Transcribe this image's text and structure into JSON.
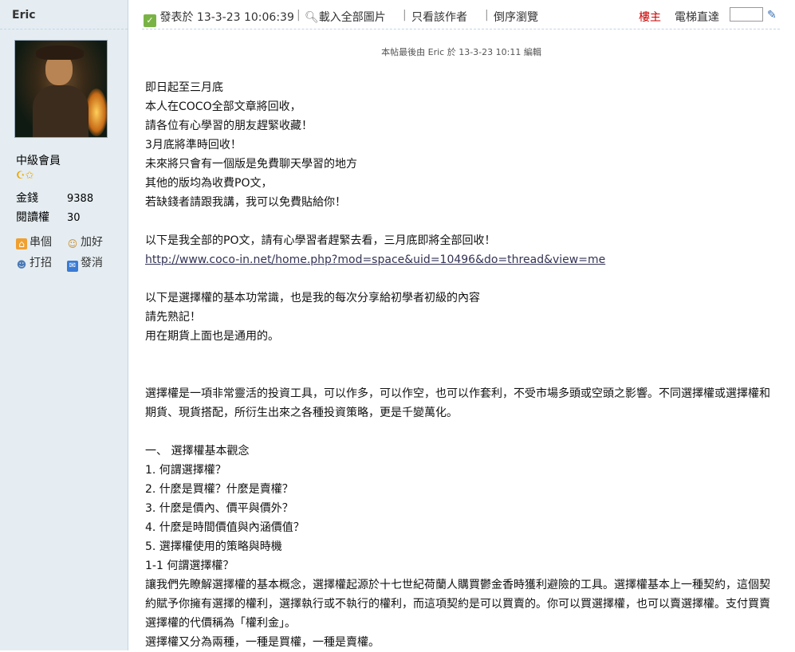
{
  "sidebar": {
    "username": "Eric",
    "rank": "中級會員",
    "stars": "☪✩",
    "stats": [
      {
        "label": "金錢",
        "value": "9388"
      },
      {
        "label": "閱讀權",
        "value": "30"
      }
    ],
    "actions": [
      {
        "label": "串個"
      },
      {
        "label": "加好"
      },
      {
        "label": "打招"
      },
      {
        "label": "發消"
      }
    ]
  },
  "toolbar": {
    "posted_prefix": "發表於",
    "posted_time": "13-3-23 10:06:39",
    "sep": "|",
    "load_images": "載入全部圖片",
    "author_only": "只看該作者",
    "reverse_view": "倒序瀏覽",
    "floor_label": "樓主",
    "elevator_label": "電梯直達"
  },
  "edit_note": "本帖最後由 Eric 於 13-3-23 10:11 編輯",
  "content": {
    "lines1": [
      "即日起至三月底",
      "本人在COCO全部文章將回收，",
      "請各位有心學習的朋友趕緊收藏！",
      "3月底將準時回收！",
      "未來將只會有一個版是免費聊天學習的地方",
      "其他的版均為收費PO文，",
      "若缺錢者請跟我講，我可以免費貼給你！"
    ],
    "po_line": "以下是我全部的PO文，請有心學習者趕緊去看，三月底即將全部回收！",
    "link": "http://www.coco-in.net/home.php?mod=space&uid=10496&do=thread&view=me",
    "lines2": [
      "以下是選擇權的基本功常識，也是我的每次分享給初學者初級的內容",
      "請先熟記！",
      "用在期貨上面也是通用的。"
    ],
    "intro": "選擇權是一項非常靈活的投資工具，可以作多，可以作空，也可以作套利，不受市場多頭或空頭之影響。不同選擇權或選擇權和期貨、現貨搭配，所衍生出來之各種投資策略，更是千變萬化。",
    "section_title": "一、 選擇權基本觀念",
    "items": [
      "1. 何謂選擇權？",
      "2. 什麼是買權？什麼是賣權？",
      "3. 什麼是價內、價平與價外？",
      "4. 什麼是時間價值與內涵價值？",
      "5. 選擇權使用的策略與時機"
    ],
    "sub_title": "1-1 何謂選擇權？",
    "para1": "讓我們先瞭解選擇權的基本概念，選擇權起源於十七世紀荷蘭人購買鬱金香時獲利避險的工具。選擇權基本上一種契約，這個契約賦予你擁有選擇的權利，選擇執行或不執行的權利，而這項契約是可以買賣的。你可以買選擇權，也可以賣選擇權。支付買賣選擇權的代價稱為「權利金」。",
    "para2": "選擇權又分為兩種，一種是買權，一種是賣權。"
  }
}
